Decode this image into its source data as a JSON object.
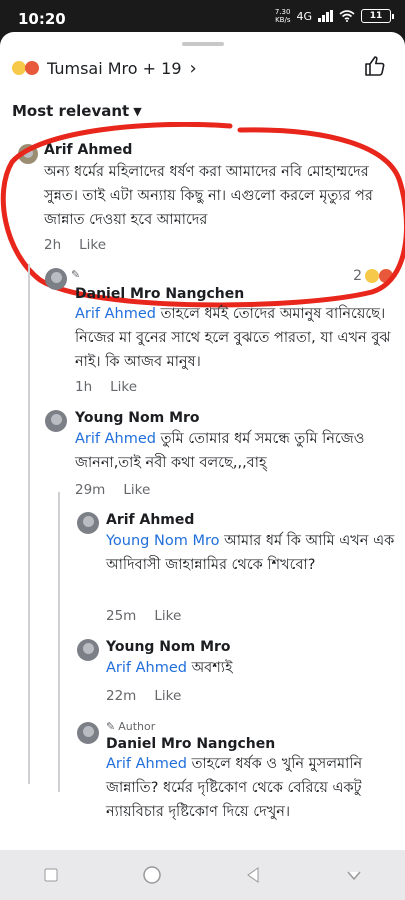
{
  "status": {
    "time": "10:20",
    "net_speed_value": "7.30",
    "net_speed_unit": "KB/s",
    "network": "4G",
    "battery": "11"
  },
  "header": {
    "reactions_label": "Tumsai Mro + 19",
    "sort_label": "Most relevant"
  },
  "comments": [
    {
      "name": "Arif Ahmed",
      "text": "অন্য ধর্মের মহিলাদের ধর্ষণ করা আমাদের নবি মোহাম্মদের সুন্নত। তাই এটা অন্যায় কিছু না। এগুলো করলে মৃত্যুর পর জান্নাত দেওয়া হবে আমাদের",
      "time": "2h",
      "like": "Like",
      "reaction_count": "2"
    },
    {
      "name": "Daniel Mro Nangchen",
      "mention": "Arif Ahmed",
      "text": "তাহলে ধর্মই তোদের অমানুষ বানিয়েছে। নিজের মা বুনের সাথে হলে বুঝতে পারতা, যা এখন বুঝ নাই।  কি আজব মানুষ।",
      "time": "1h",
      "like": "Like"
    },
    {
      "name": "Young Nom Mro",
      "mention": "Arif Ahmed",
      "text": "তুমি তোমার ধর্ম সমন্ধে তুমি নিজেও জাননা,তাই নবী কথা বলছে,,,বাহ্",
      "time": "29m",
      "like": "Like"
    },
    {
      "name": "Arif Ahmed",
      "mention": "Young Nom Mro",
      "text": "আমার ধর্ম কি আমি এখন এক আদিবাসী জাহান্নামির থেকে শিখবো?",
      "time": "25m",
      "like": "Like"
    },
    {
      "name": "Young Nom Mro",
      "mention": "Arif Ahmed",
      "text": "অবশ্যই",
      "time": "22m",
      "like": "Like"
    },
    {
      "author_tag": "Author",
      "name": "Daniel Mro Nangchen",
      "mention": "Arif Ahmed",
      "text": "তাহলে ধর্ষক ও খুনি মুসলমানি জান্নাতি? ধর্মের দৃষ্টিকোণ থেকে বেরিয়ে একটু ন্যায়বিচার দৃষ্টিকোণ দিয়ে দেখুন।"
    }
  ],
  "colors": {
    "mention": "#216fdb",
    "annotation": "#e8261b",
    "meta": "#65676b"
  }
}
